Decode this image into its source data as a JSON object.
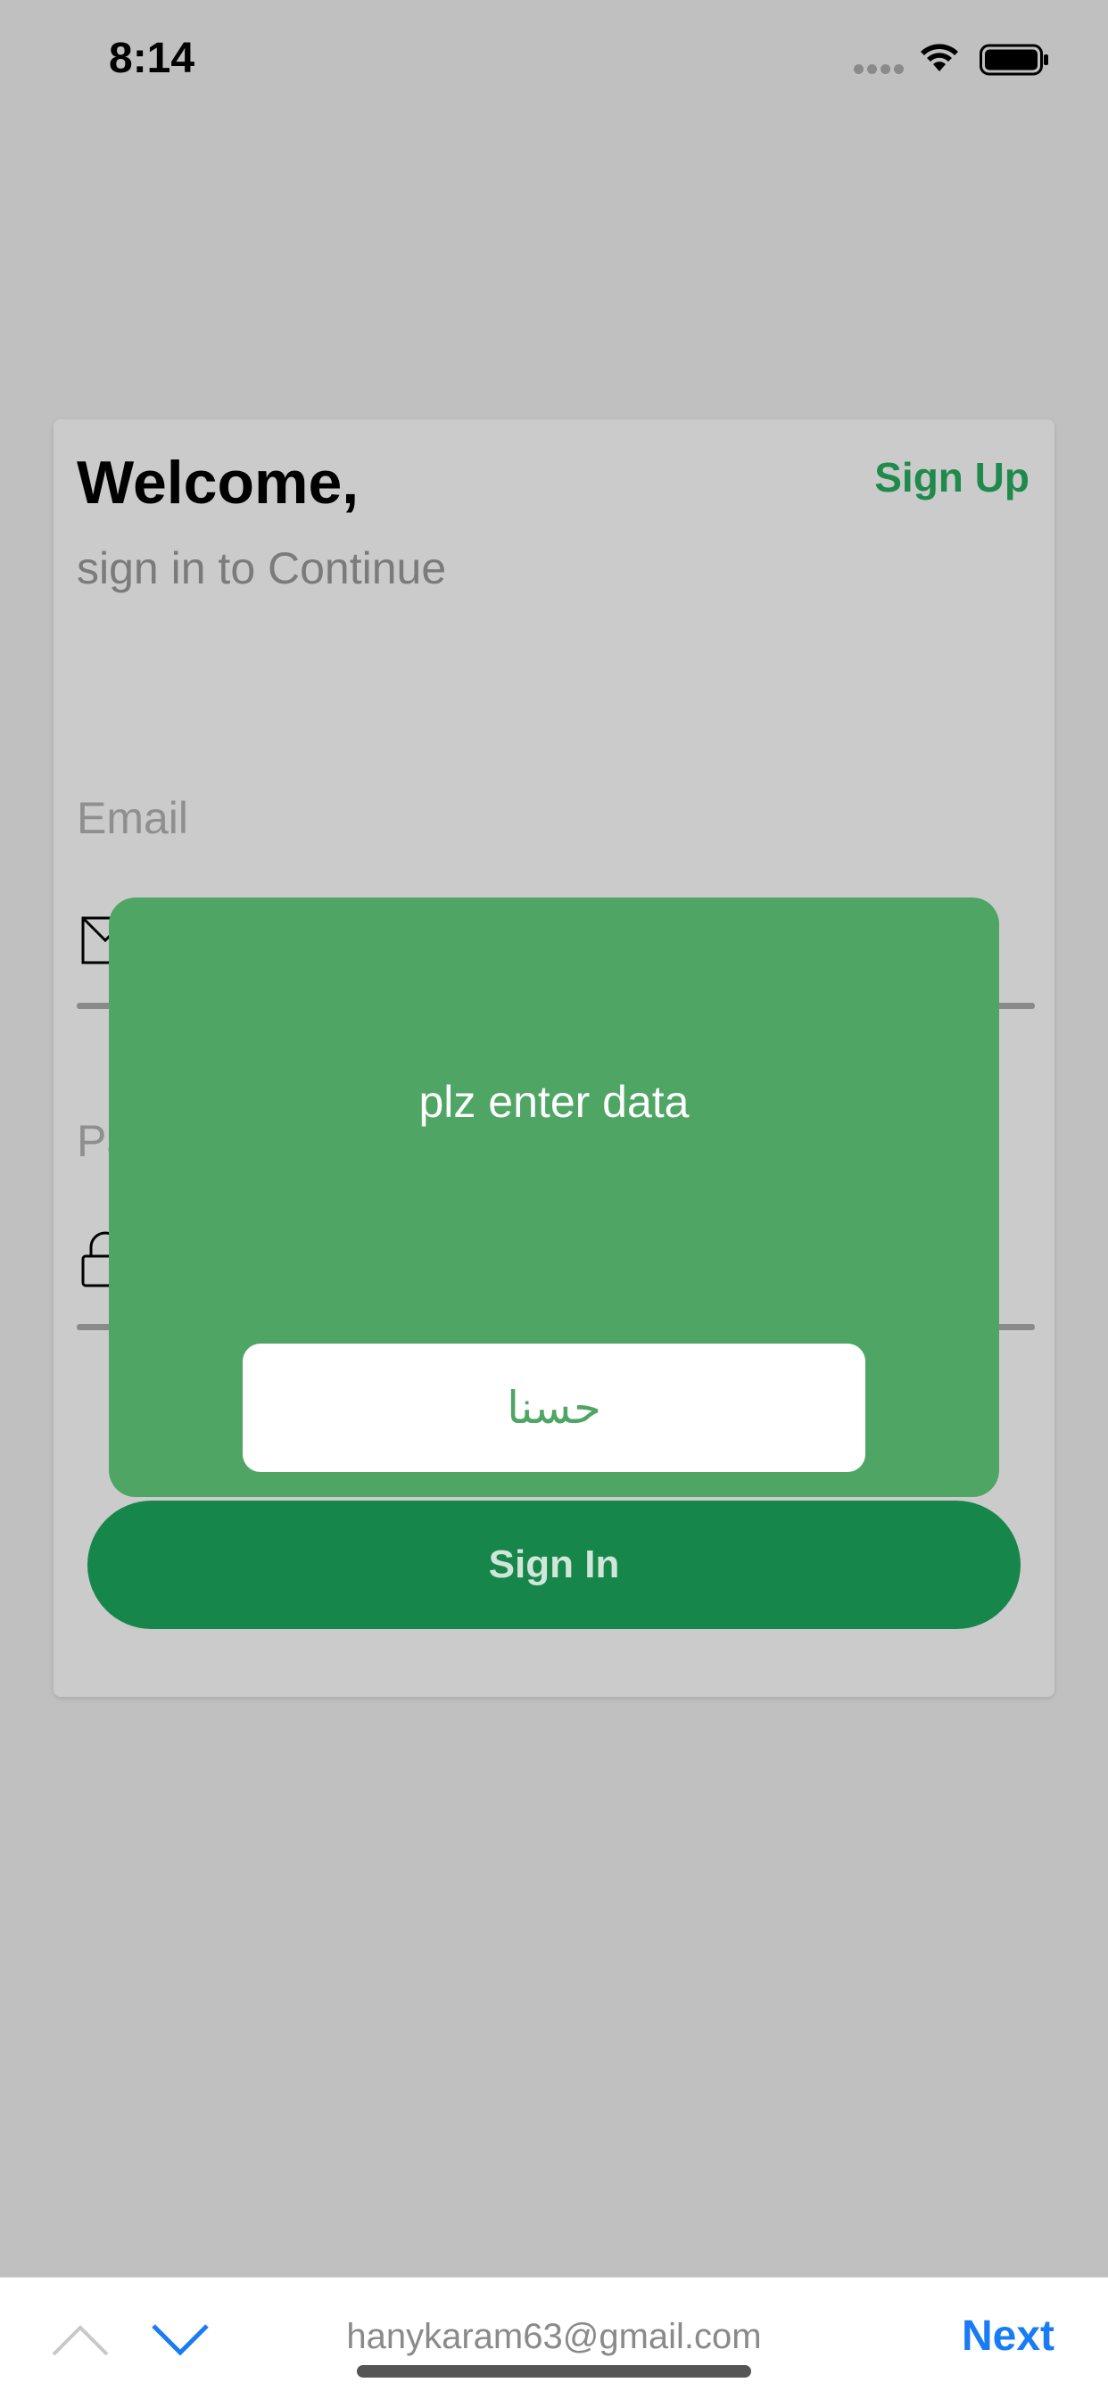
{
  "status_bar": {
    "time": "8:14"
  },
  "card": {
    "title": "Welcome,",
    "subtitle": "sign in to Continue",
    "signup_label": "Sign Up",
    "email_label": "Email",
    "password_label_partial": "Pa",
    "signin_label": "Sign In"
  },
  "dialog": {
    "message": "plz enter data",
    "ok_label": "حسنا"
  },
  "keyboard_bar": {
    "autofill_suggestion": "hanykaram63@gmail.com",
    "next_label": "Next"
  },
  "colors": {
    "accent_green": "#17864b",
    "dialog_green": "#4fa564",
    "ios_blue": "#1a7cf5"
  }
}
